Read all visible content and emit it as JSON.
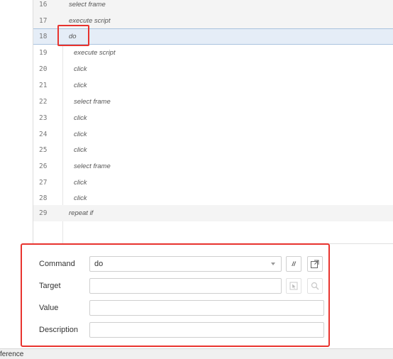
{
  "commands": [
    {
      "line": "16",
      "text": "select frame"
    },
    {
      "line": "17",
      "text": "execute script"
    },
    {
      "line": "18",
      "text": "do"
    },
    {
      "line": "19",
      "text": "execute script"
    },
    {
      "line": "20",
      "text": "click"
    },
    {
      "line": "21",
      "text": "click"
    },
    {
      "line": "22",
      "text": "select frame"
    },
    {
      "line": "23",
      "text": "click"
    },
    {
      "line": "24",
      "text": "click"
    },
    {
      "line": "25",
      "text": "click"
    },
    {
      "line": "26",
      "text": "select frame"
    },
    {
      "line": "27",
      "text": "click"
    },
    {
      "line": "28",
      "text": "click"
    },
    {
      "line": "29",
      "text": "repeat if"
    }
  ],
  "editor": {
    "command_label": "Command",
    "command_value": "do",
    "target_label": "Target",
    "target_value": "",
    "value_label": "Value",
    "value_value": "",
    "description_label": "Description",
    "description_value": "",
    "comment_toggle_label": "//"
  },
  "status_bar": {
    "text": "ference"
  },
  "colors": {
    "highlight": "#e8332e",
    "selected_row": "#e5edf7"
  }
}
